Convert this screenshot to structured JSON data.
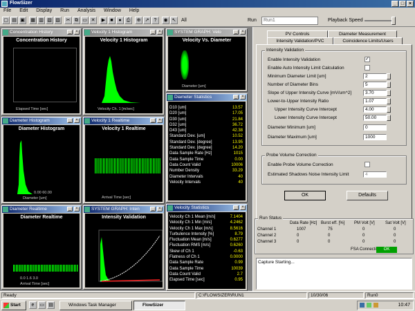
{
  "app": {
    "title": "FlowSizer"
  },
  "menu": [
    "File",
    "Edit",
    "Display",
    "Run",
    "Analysis",
    "Window",
    "Help"
  ],
  "toolbar": {
    "all_label": "All",
    "run_label": "Run",
    "run_value": "Run1",
    "playback_label": "Playback Speed"
  },
  "windows": {
    "conc_hist": {
      "caption": "Concentration History",
      "title": "Concentration History",
      "xlabel": "Elapsed Time [sec]"
    },
    "vel_hist": {
      "caption": "Velocity 1 Histogram",
      "title": "Velocity 1 Histogram",
      "xlabel": "Velocity Ch. 1 [m/sec]"
    },
    "sysgraph1": {
      "caption": "SYSTEM GRAPH: Velo",
      "title": "Velocity Vs. Diameter",
      "xlabel": "Diameter [um]"
    },
    "diam_hist": {
      "caption": "Diameter Histogram",
      "title": "Diameter Histogram",
      "xlabel": "Diameter [um]",
      "xtick": "0.00 60.00"
    },
    "vel_rt": {
      "caption": "Velocity 1 Realtime",
      "title": "Velocity 1 Realtime",
      "xlabel": "Arrival Time [sec]"
    },
    "diam_rt": {
      "caption": "Diameter Realtime",
      "title": "Diameter Realtime",
      "xlabel": "Arrival Time [sec]",
      "xtick": "0.0  1.6  3.0"
    },
    "sysgraph2": {
      "caption": "SYSTEM GRAPH: Inten",
      "title": "Intensity Validation",
      "xlabel": "Diameter [um]"
    }
  },
  "diameter_stats": {
    "caption": "Diameter Statistics",
    "rows": [
      {
        "k": "D10 [um]",
        "v": "13.57"
      },
      {
        "k": "D20 [um]",
        "v": "17.05"
      },
      {
        "k": "D30 [um]",
        "v": "21.84"
      },
      {
        "k": "D32 [um]",
        "v": "36.72"
      },
      {
        "k": "D43 [um]",
        "v": "42.38"
      },
      {
        "k": "Standard Dev. [um]",
        "v": "10.52"
      },
      {
        "k": "Standard Dev. [degree]",
        "v": "13.95"
      },
      {
        "k": "Standard Dev. [degree]",
        "v": "14.20"
      },
      {
        "k": "Data Sample Rate [Hz]",
        "v": "1015"
      },
      {
        "k": "Data Sample Time",
        "v": "0.00"
      },
      {
        "k": "Data Count Valid",
        "v": "10006"
      },
      {
        "k": "Number Density",
        "v": "33.29"
      },
      {
        "k": "Diameter Intervals",
        "v": "40"
      },
      {
        "k": "Velocity Intervals",
        "v": "40"
      }
    ]
  },
  "velocity_stats": {
    "caption": "Velocity Statistics",
    "rows": [
      {
        "k": "Velocity Ch 1 Mean [m/s]",
        "v": "7.1404"
      },
      {
        "k": "Velocity Ch 1 Min [m/s]",
        "v": "4.2462"
      },
      {
        "k": "Velocity Ch 1 Max [m/s]",
        "v": "8.5616"
      },
      {
        "k": "Turbulence Intensity [%]",
        "v": "8.79"
      },
      {
        "k": "Fluctuation Mean [m/s]",
        "v": "0.6277"
      },
      {
        "k": "Fluctuation RMS [m/s]",
        "v": "0.6260"
      },
      {
        "k": "Skew of Ch 1",
        "v": "-0.63"
      },
      {
        "k": "Flatness of Ch 1",
        "v": "0.0000"
      },
      {
        "k": "Data Sample Rate",
        "v": "0.99"
      },
      {
        "k": "Data Sample Time",
        "v": "10039"
      },
      {
        "k": "Data Count Valid",
        "v": "2.7"
      },
      {
        "k": "Elapsed Time [sec]",
        "v": "0.95"
      }
    ]
  },
  "panel": {
    "tabs_top": [
      "PV Controls",
      "Diameter Measurement"
    ],
    "tabs_bottom": [
      "Intensity Validation/PVC",
      "Coincidence Limits/Users"
    ],
    "intensity_group": "Intensity Validation",
    "fields": [
      {
        "label": "Enable Intensity Validation",
        "type": "check",
        "value": "✓"
      },
      {
        "label": "Enable Auto Intensity Limit Calculation",
        "type": "check",
        "value": ""
      },
      {
        "label": "Minimum Diameter Limit [um]",
        "type": "input",
        "value": "2"
      },
      {
        "label": "Number of Diameter Bins",
        "type": "input",
        "value": "5"
      },
      {
        "label": "Slope of Upper Intensity Curve [mV/um^2]",
        "type": "input",
        "value": "3.70"
      },
      {
        "label": "Lower-to-Upper Intensity Ratio",
        "type": "input",
        "value": "1.07"
      },
      {
        "label": "Upper Intensity Curve Intercept",
        "type": "input",
        "value": "4.00"
      },
      {
        "label": "Lower Intensity Curve Intercept",
        "type": "input",
        "value": "50.00"
      },
      {
        "label": "Diameter Minimum [um]",
        "type": "input",
        "value": "0"
      },
      {
        "label": "Diameter Maximum [um]",
        "type": "input",
        "value": "1000"
      }
    ],
    "pvc_group": "Probe Volume Correction",
    "pvc_fields": [
      {
        "label": "Enable Probe Volume Correction",
        "type": "check",
        "value": ""
      },
      {
        "label": "Estimated Shadows Noise Intensity Limit",
        "type": "input",
        "value": "4"
      }
    ],
    "ok_label": "OK",
    "defaults_label": "Defaults",
    "run_status": {
      "group": "Run Status",
      "headers": [
        "Data Rate [Hz]",
        "Burst eff. [%]",
        "PM Volt [V]",
        "Sat Volt [V]"
      ],
      "rows": [
        {
          "name": "Channel 1",
          "vals": [
            "1007",
            "75",
            "0",
            "0"
          ]
        },
        {
          "name": "Channel 2",
          "vals": [
            "0",
            "0",
            "0",
            "0"
          ]
        },
        {
          "name": "Channel 3",
          "vals": [
            "0",
            "0",
            "0",
            "0"
          ]
        }
      ],
      "fsa_label": "FSA Connection",
      "fsa_status": "OK"
    },
    "log_text": "Capture Starting..."
  },
  "statusbar": [
    "Ready",
    "C:\\FLOWSIZER\\RUN1",
    "10/30/06",
    "Run0"
  ],
  "taskbar": {
    "start": "Start",
    "tasks": [
      "Windows Task Manager",
      "FlowSizer"
    ],
    "clock": "10:47"
  },
  "colors": {
    "plot_green": "#00ff00",
    "plot_red": "#ff2020",
    "stat_yellow": "#ffff00",
    "title_blue": "#0a246a"
  }
}
